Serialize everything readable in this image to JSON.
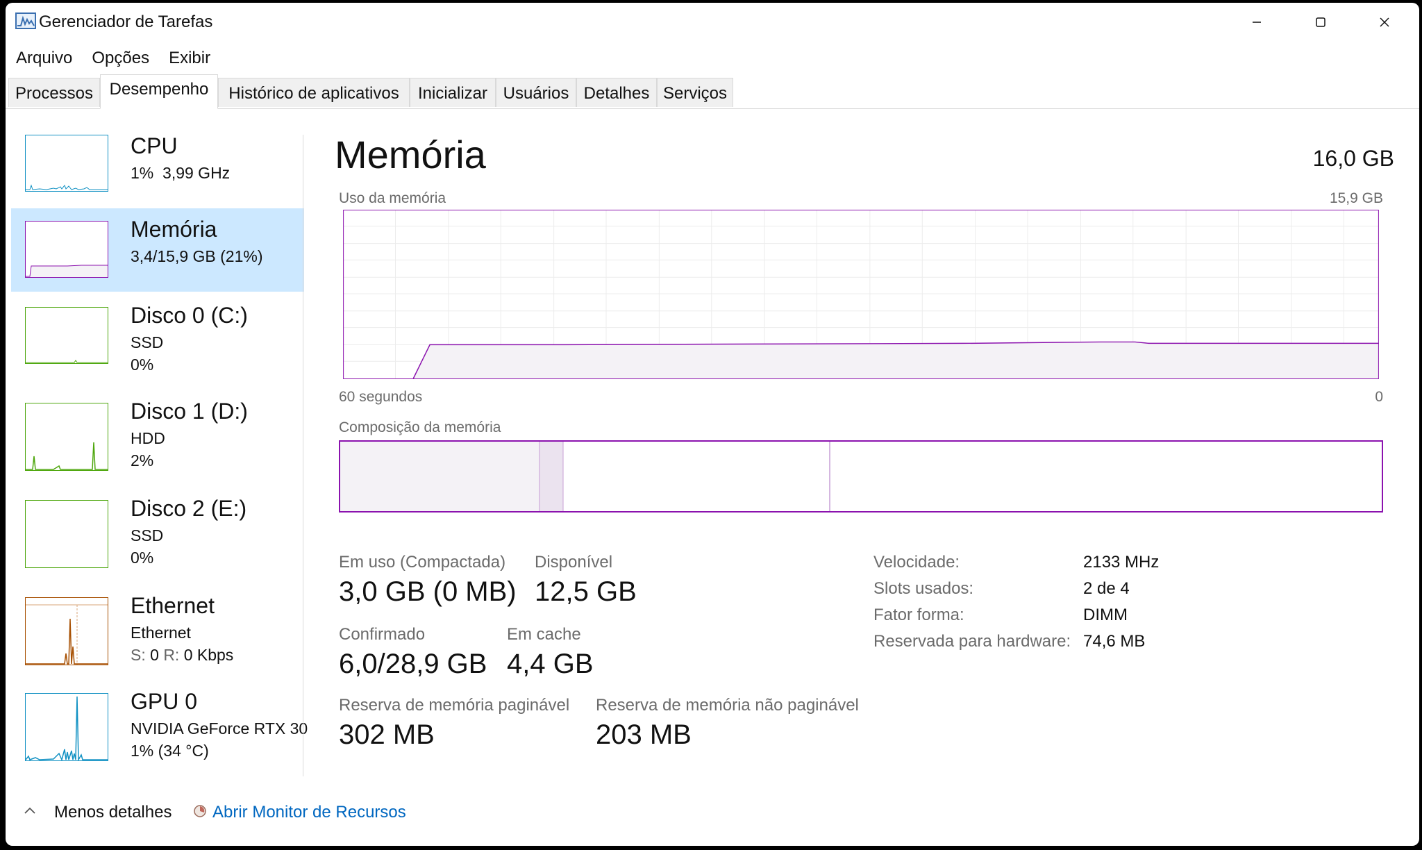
{
  "window": {
    "title": "Gerenciador de Tarefas",
    "controls": {
      "minimize_icon": "minimize-icon",
      "maximize_icon": "maximize-icon",
      "close_icon": "close-icon"
    }
  },
  "menu": [
    "Arquivo",
    "Opções",
    "Exibir"
  ],
  "tabs": {
    "items": [
      "Processos",
      "Desempenho",
      "Histórico de aplicativos",
      "Inicializar",
      "Usuários",
      "Detalhes",
      "Serviços"
    ],
    "active": "Desempenho"
  },
  "sidebar": {
    "cpu": {
      "title": "CPU",
      "usage": "1%",
      "speed": "3,99 GHz"
    },
    "memory": {
      "title": "Memória",
      "usage": "3,4/15,9 GB (21%)"
    },
    "disk0": {
      "title": "Disco 0 (C:)",
      "type": "SSD",
      "usage": "0%"
    },
    "disk1": {
      "title": "Disco 1 (D:)",
      "type": "HDD",
      "usage": "2%"
    },
    "disk2": {
      "title": "Disco 2 (E:)",
      "type": "SSD",
      "usage": "0%"
    },
    "ethernet": {
      "title": "Ethernet",
      "adapter": "Ethernet",
      "send_label": "S:",
      "send_value": "0",
      "recv_label": "R:",
      "recv_value": "0 Kbps"
    },
    "gpu": {
      "title": "GPU 0",
      "model": "NVIDIA GeForce RTX 30",
      "usage": "1% (34 °C)"
    }
  },
  "main": {
    "title": "Memória",
    "capacity": "16,0 GB",
    "usage_label": "Uso da memória",
    "usage_max": "15,9 GB",
    "axis_left": "60 segundos",
    "axis_right": "0",
    "composition_label": "Composição da memória",
    "stats": {
      "in_use_label": "Em uso (Compactada)",
      "in_use_value": "3,0 GB (0 MB)",
      "available_label": "Disponível",
      "available_value": "12,5 GB",
      "committed_label": "Confirmado",
      "committed_value": "6,0/28,9 GB",
      "cached_label": "Em cache",
      "cached_value": "4,4 GB",
      "paged_label": "Reserva de memória paginável",
      "paged_value": "302 MB",
      "nonpaged_label": "Reserva de memória não paginável",
      "nonpaged_value": "203 MB"
    },
    "details": {
      "speed_label": "Velocidade:",
      "speed_value": "2133 MHz",
      "slots_label": "Slots usados:",
      "slots_value": "2 de 4",
      "form_label": "Fator forma:",
      "form_value": "DIMM",
      "reserved_label": "Reservada para hardware:",
      "reserved_value": "74,6 MB"
    }
  },
  "footer": {
    "less_details": "Menos detalhes",
    "open_monitor": "Abrir Monitor de Recursos"
  },
  "colors": {
    "memory": "#8b12ae",
    "memory_fill": "#f4f2f6",
    "cpu": "#1191c3",
    "disk": "#4da60c",
    "ethernet": "#a74f01",
    "gpu": "#1191c3",
    "selected_bg": "#cce8ff",
    "link": "#0067c0"
  }
}
